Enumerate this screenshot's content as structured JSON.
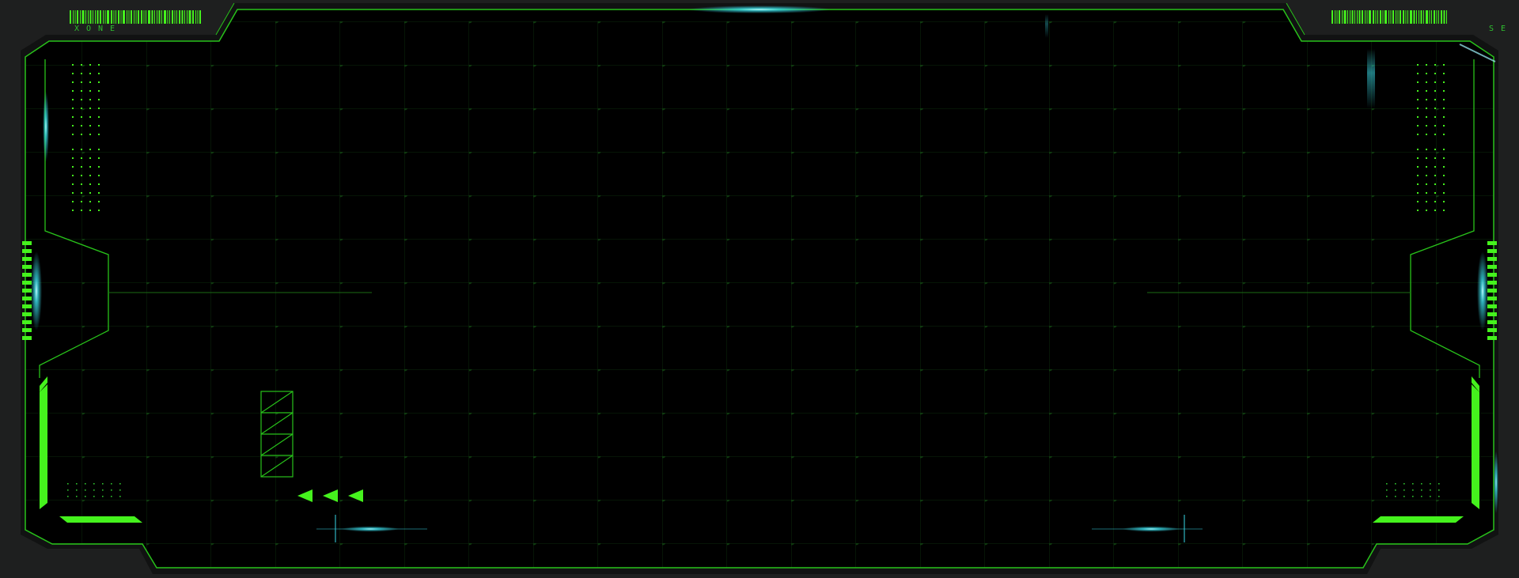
{
  "theme": {
    "background": "#1e1f1f",
    "screen": "#000000",
    "accent_green": "#45f21d",
    "line_green": "#28c21a",
    "dim_green": "#0e3a0e",
    "glow_cyan": "#39d9e6"
  },
  "hud": {
    "label_left": "XONE",
    "label_right": "SE",
    "barcode_left_icon": "barcode-icon",
    "barcode_right_icon": "barcode-icon",
    "arrow_icons": [
      "triangle-left-icon",
      "triangle-left-icon",
      "triangle-left-icon"
    ],
    "stack_segments": 4
  }
}
